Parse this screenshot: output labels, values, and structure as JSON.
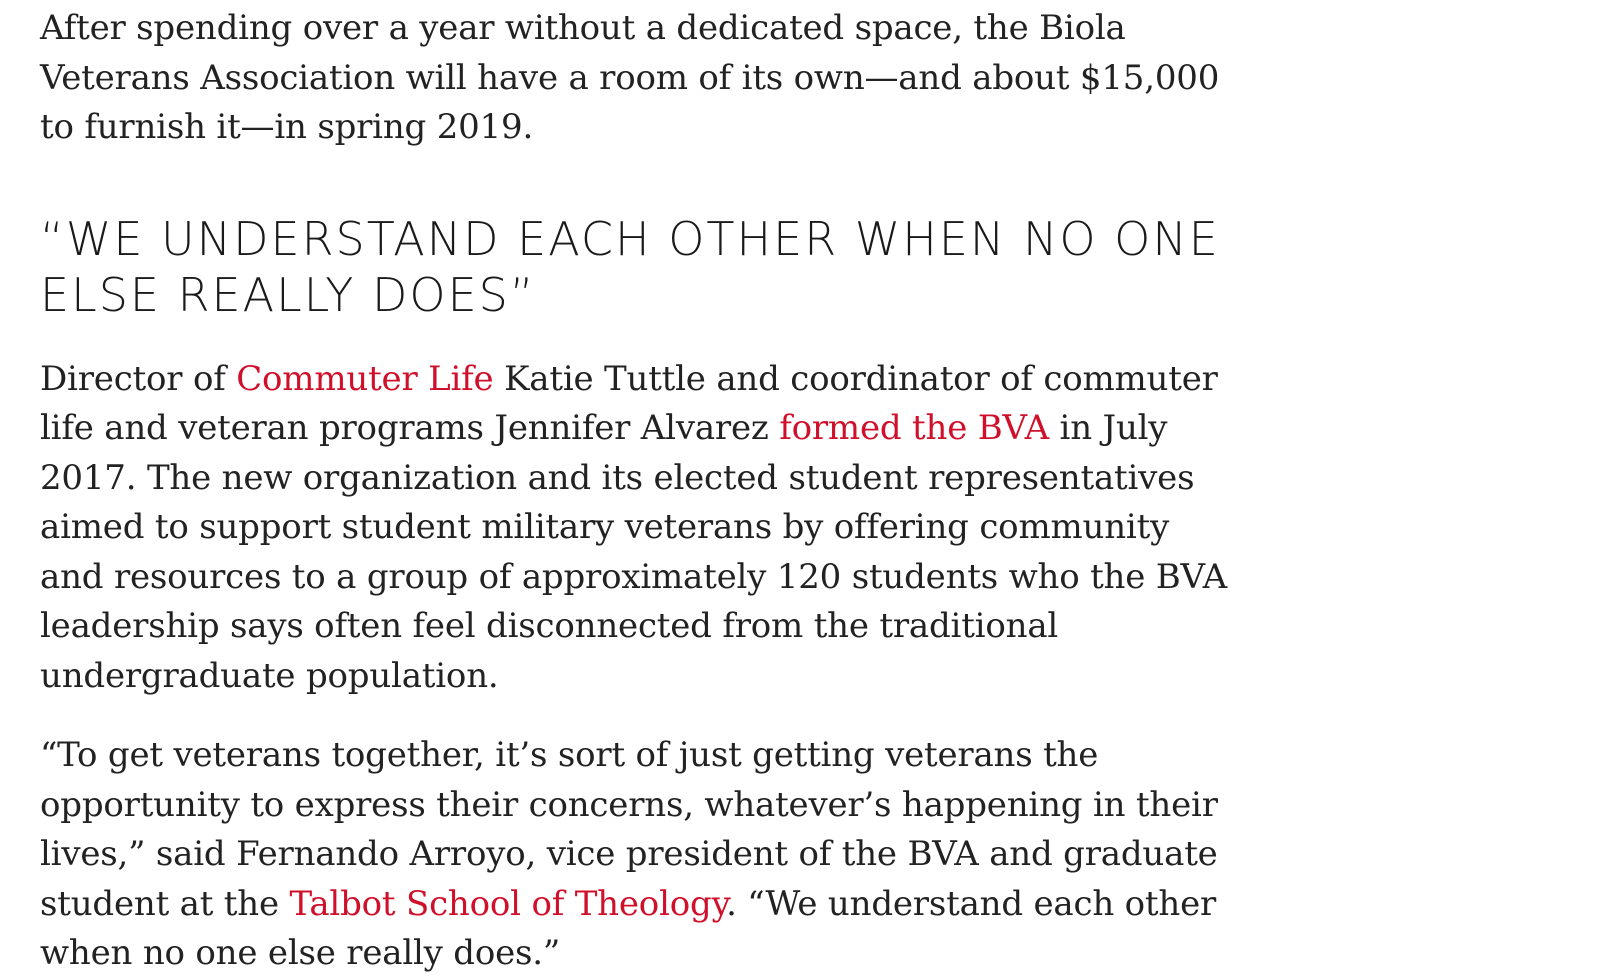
{
  "article": {
    "intro": "After spending over a year without a dedicated space, the Biola Veterans Association will have a room of its own—and about $15,000 to furnish it—in spring 2019.",
    "heading": "“We understand each other when no one else really does”",
    "para2": {
      "t1": "Director of ",
      "link1": "Commuter Life",
      "t2": " Katie Tuttle and coordinator of commuter life and veteran programs Jennifer Alvarez ",
      "link2": "formed the BVA",
      "t3": " in July 2017. The new organization and its elected student representatives aimed to support student military veterans by offering community and resources to a group of approximately 120 students who the BVA leadership says often feel disconnected from the traditional undergraduate population."
    },
    "para3": {
      "t1": "“To get veterans together, it’s sort of just getting veterans the opportunity to express their concerns, whatever’s happening in their lives,” said Fernando Arroyo, vice president of the BVA and graduate student at the ",
      "link1": "Talbot School of Theology",
      "t2": ". “We understand each other when no one else really does.”"
    }
  },
  "colors": {
    "text": "#222222",
    "link": "#d0102a"
  }
}
